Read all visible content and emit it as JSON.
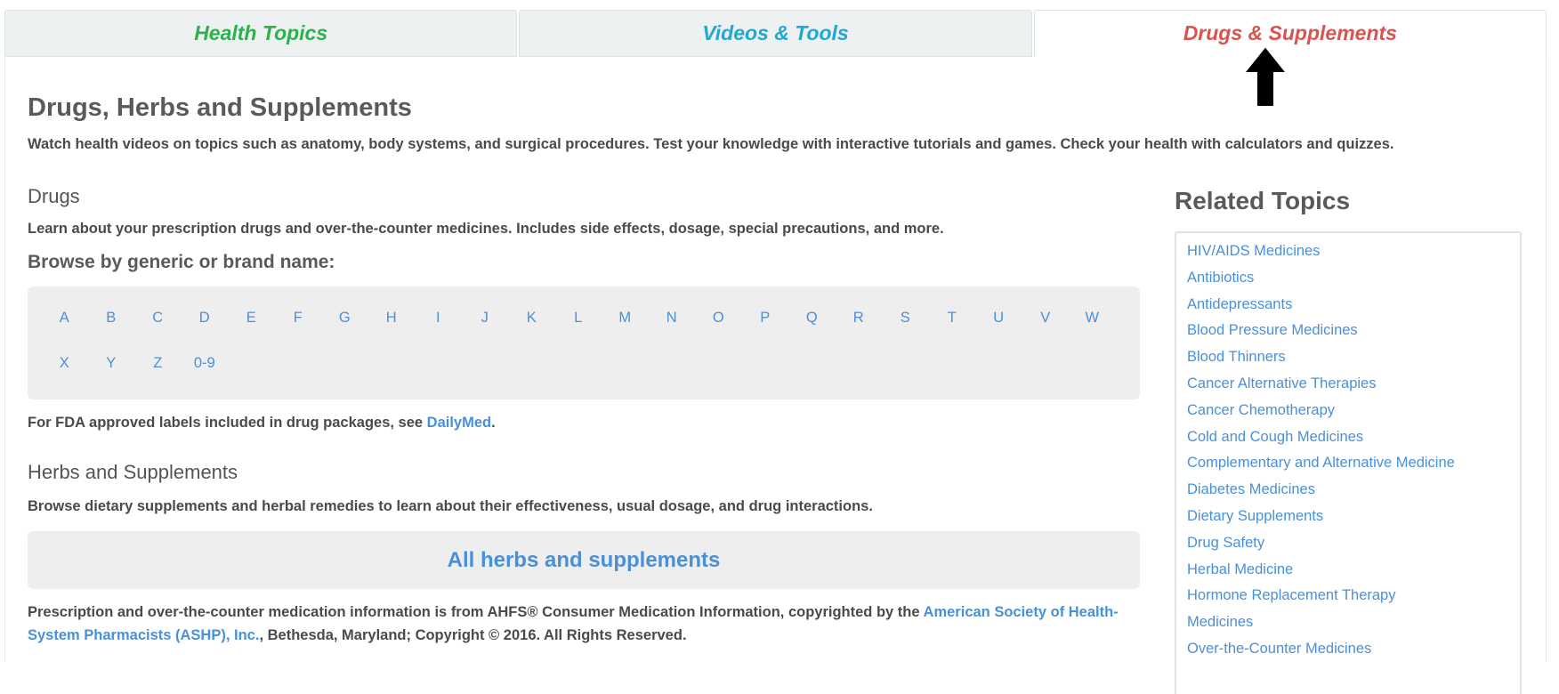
{
  "tabs": [
    {
      "label": "Health Topics"
    },
    {
      "label": "Videos & Tools"
    },
    {
      "label": "Drugs & Supplements"
    }
  ],
  "page": {
    "title": "Drugs, Herbs and Supplements",
    "intro": "Watch health videos on topics such as anatomy, body systems, and surgical procedures. Test your knowledge with interactive tutorials and games. Check your health with calculators and quizzes."
  },
  "drugs": {
    "heading": "Drugs",
    "description": "Learn about your prescription drugs and over-the-counter medicines. Includes side effects, dosage, special precautions, and more.",
    "browse_heading": "Browse by generic or brand name:",
    "letters_row1": [
      "A",
      "B",
      "C",
      "D",
      "E",
      "F",
      "G",
      "H",
      "I",
      "J",
      "K",
      "L",
      "M",
      "N",
      "O",
      "P",
      "Q",
      "R",
      "S",
      "T",
      "U",
      "V",
      "W"
    ],
    "letters_row2": [
      "X",
      "Y",
      "Z",
      "0-9"
    ],
    "fda_prefix": "For FDA approved labels included in drug packages, see ",
    "fda_link": "DailyMed",
    "fda_suffix": "."
  },
  "herbs": {
    "heading": "Herbs and Supplements",
    "description": "Browse dietary supplements and herbal remedies to learn about their effectiveness, usual dosage, and drug interactions.",
    "button_label": "All herbs and supplements"
  },
  "ahfs": {
    "prefix": "Prescription and over-the-counter medication information is from AHFS® Consumer Medication Information, copyrighted by the ",
    "link": "American Society of Health-System Pharmacists (ASHP), Inc.",
    "suffix": ", Bethesda, Maryland; Copyright © 2016. All Rights Reserved."
  },
  "related": {
    "heading": "Related Topics",
    "items": [
      "HIV/AIDS Medicines",
      "Antibiotics",
      "Antidepressants",
      "Blood Pressure Medicines",
      "Blood Thinners",
      "Cancer Alternative Therapies",
      "Cancer Chemotherapy",
      "Cold and Cough Medicines",
      "Complementary and Alternative Medicine",
      "Diabetes Medicines",
      "Dietary Supplements",
      "Drug Safety",
      "Herbal Medicine",
      "Hormone Replacement Therapy",
      "Medicines",
      "Over-the-Counter Medicines"
    ]
  },
  "colors": {
    "tab_health": "#2bb24c",
    "tab_videos": "#20a7d3",
    "tab_drugs": "#d9534f",
    "link": "#4a90d9"
  },
  "icons": {
    "cursor": "arrow-up-cursor-icon"
  }
}
